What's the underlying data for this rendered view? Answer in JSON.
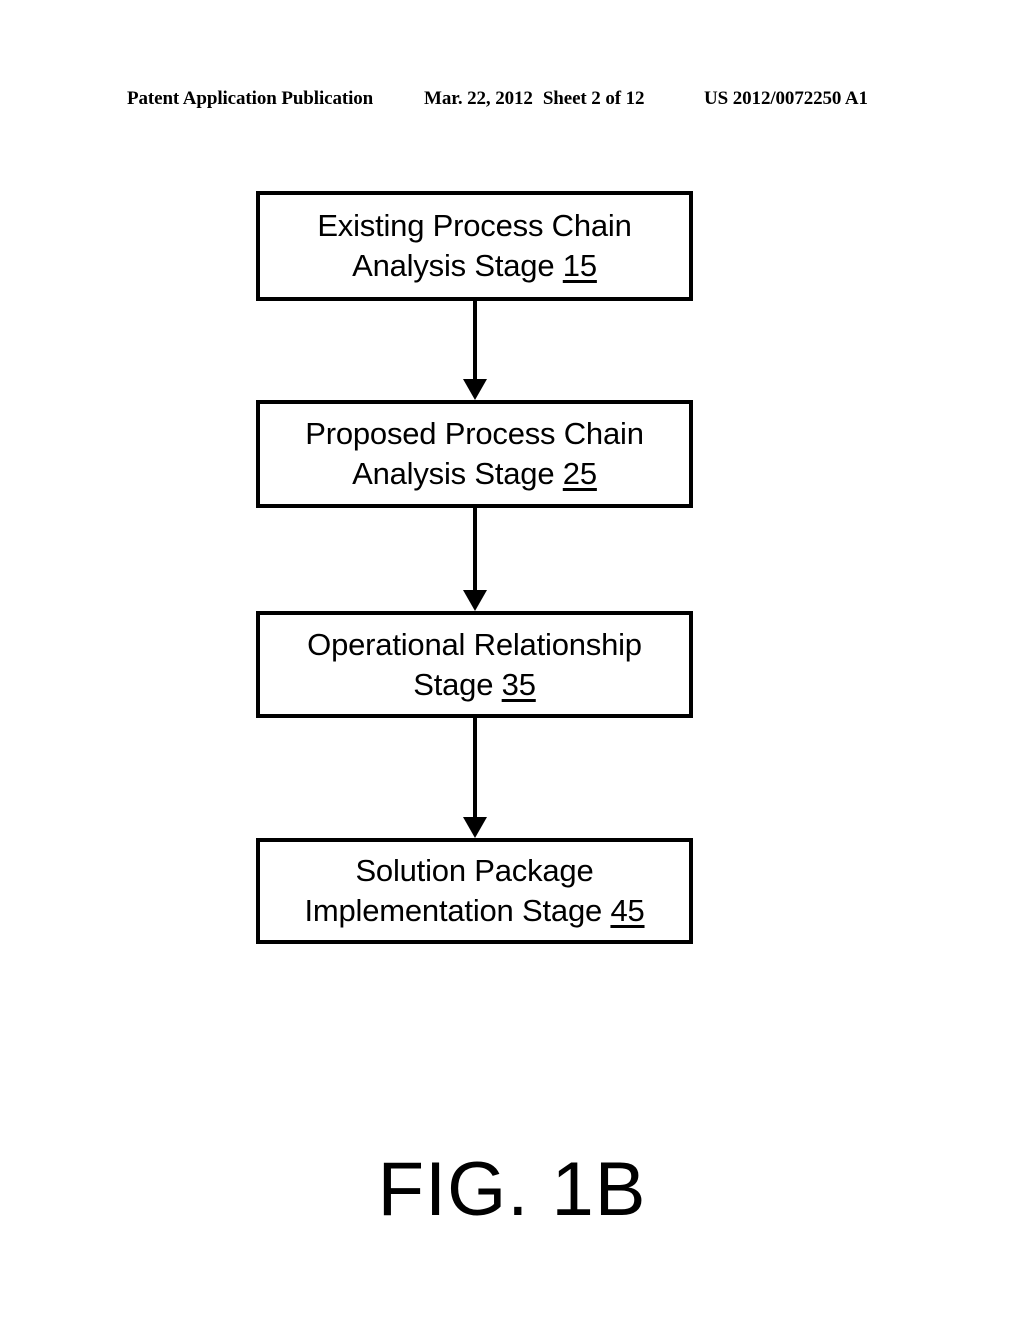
{
  "header": {
    "publication": "Patent Application Publication",
    "date": "Mar. 22, 2012",
    "sheet": "Sheet 2 of 12",
    "patent_number": "US 2012/0072250 A1"
  },
  "figure": {
    "caption": "FIG. 1B",
    "type": "flowchart",
    "orientation": "vertical",
    "ink_color": "#000000",
    "background_color": "#ffffff"
  },
  "flowchart": {
    "nodes": [
      {
        "id": "node-1",
        "line1": "Existing Process Chain",
        "line2": "Analysis Stage ",
        "ref": "15"
      },
      {
        "id": "node-2",
        "line1": "Proposed Process Chain",
        "line2": "Analysis Stage ",
        "ref": "25"
      },
      {
        "id": "node-3",
        "line1": "Operational Relationship",
        "line2": "Stage ",
        "ref": "35"
      },
      {
        "id": "node-4",
        "line1": "Solution Package",
        "line2": "Implementation Stage ",
        "ref": "45"
      }
    ],
    "connectors": [
      {
        "id": "conn-1",
        "from": "node-1",
        "to": "node-2",
        "style": "arrow-down"
      },
      {
        "id": "conn-2",
        "from": "node-2",
        "to": "node-3",
        "style": "arrow-down"
      },
      {
        "id": "conn-3",
        "from": "node-3",
        "to": "node-4",
        "style": "arrow-down"
      }
    ]
  }
}
